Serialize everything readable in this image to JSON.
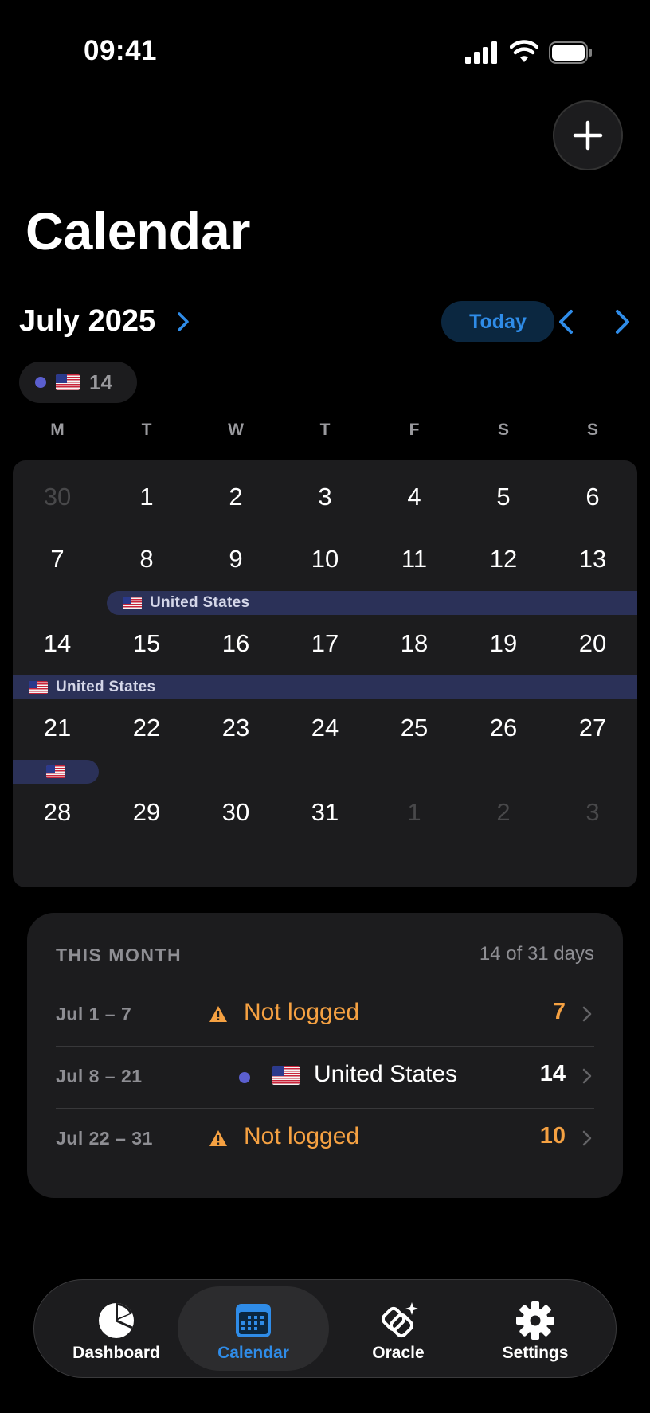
{
  "status_bar": {
    "time": "09:41"
  },
  "header": {
    "title": "Calendar"
  },
  "month_nav": {
    "month_label": "July 2025",
    "today_label": "Today"
  },
  "summary_chip": {
    "count": "14"
  },
  "weekdays": [
    "M",
    "T",
    "W",
    "T",
    "F",
    "S",
    "S"
  ],
  "calendar": {
    "weeks": [
      [
        {
          "d": "30",
          "m": true
        },
        {
          "d": "1"
        },
        {
          "d": "2"
        },
        {
          "d": "3"
        },
        {
          "d": "4"
        },
        {
          "d": "5"
        },
        {
          "d": "6"
        }
      ],
      [
        {
          "d": "7"
        },
        {
          "d": "8"
        },
        {
          "d": "9"
        },
        {
          "d": "10"
        },
        {
          "d": "11"
        },
        {
          "d": "12"
        },
        {
          "d": "13"
        }
      ],
      [
        {
          "d": "14"
        },
        {
          "d": "15"
        },
        {
          "d": "16"
        },
        {
          "d": "17"
        },
        {
          "d": "18"
        },
        {
          "d": "19"
        },
        {
          "d": "20"
        }
      ],
      [
        {
          "d": "21"
        },
        {
          "d": "22"
        },
        {
          "d": "23"
        },
        {
          "d": "24"
        },
        {
          "d": "25"
        },
        {
          "d": "26"
        },
        {
          "d": "27"
        }
      ],
      [
        {
          "d": "28"
        },
        {
          "d": "29"
        },
        {
          "d": "30"
        },
        {
          "d": "31"
        },
        {
          "d": "1",
          "m": true
        },
        {
          "d": "2",
          "m": true
        },
        {
          "d": "3",
          "m": true
        }
      ]
    ],
    "event_label": "United States"
  },
  "this_month": {
    "header": "THIS MONTH",
    "count": "14 of 31 days",
    "rows": [
      {
        "range": "Jul 1 – 7",
        "label": "Not logged",
        "days": "7"
      },
      {
        "range": "Jul 8 – 21",
        "label": "United States",
        "days": "14"
      },
      {
        "range": "Jul 22 – 31",
        "label": "Not logged",
        "days": "10"
      }
    ]
  },
  "tabs": [
    {
      "label": "Dashboard",
      "icon": "pie-chart-icon"
    },
    {
      "label": "Calendar",
      "icon": "calendar-icon"
    },
    {
      "label": "Oracle",
      "icon": "oracle-icon"
    },
    {
      "label": "Settings",
      "icon": "gear-icon"
    }
  ],
  "colors": {
    "accent": "#2f8ce8",
    "warning": "#f5a142",
    "event_bar": "#2b3158",
    "country_dot": "#5b5fcf"
  }
}
